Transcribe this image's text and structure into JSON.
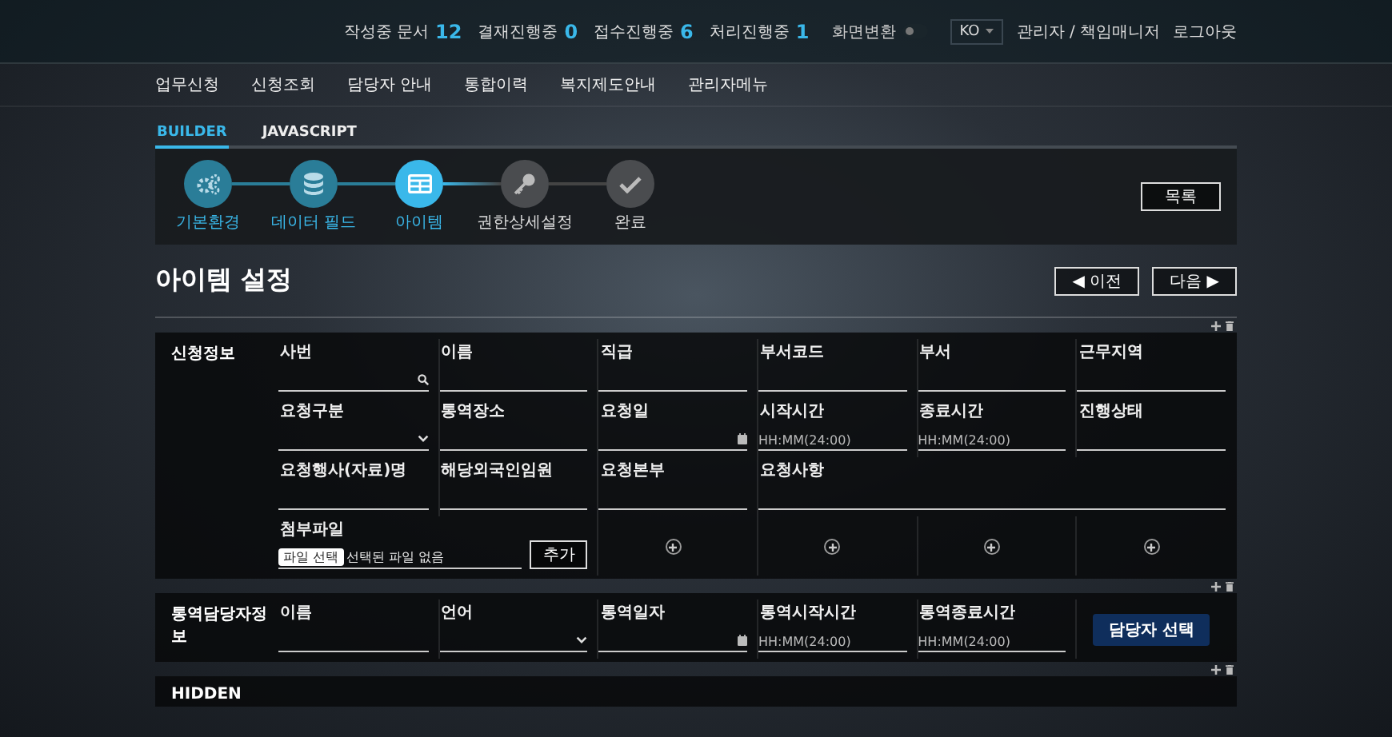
{
  "header": {
    "counters": [
      {
        "label": "작성중 문서",
        "value": "12"
      },
      {
        "label": "결재진행중",
        "value": "0"
      },
      {
        "label": "접수진행중",
        "value": "6"
      },
      {
        "label": "처리진행중",
        "value": "1"
      }
    ],
    "toggle": {
      "label": "화면변환",
      "on": false
    },
    "language": "KO",
    "user": "관리자 / 책임매니저",
    "logout": "로그아웃"
  },
  "nav": [
    "업무신청",
    "신청조회",
    "담당자 안내",
    "통합이력",
    "복지제도안내",
    "관리자메뉴"
  ],
  "tabs": [
    {
      "label": "BUILDER",
      "selected": true
    },
    {
      "label": "JAVASCRIPT",
      "selected": false
    }
  ],
  "steps": [
    {
      "label": "기본환경",
      "completed": true,
      "selected": false
    },
    {
      "label": "데이터 필드",
      "completed": true,
      "selected": false
    },
    {
      "label": "아이템",
      "completed": false,
      "selected": true
    },
    {
      "label": "권한상세설정",
      "completed": false,
      "selected": false
    },
    {
      "label": "완료",
      "completed": false,
      "selected": false
    }
  ],
  "list_button": "목록",
  "page_title": "아이템 설정",
  "prev_button": "◀ 이전",
  "next_button": "다음 ▶",
  "sections": [
    {
      "title": "신청정보",
      "rows": [
        [
          {
            "kind": "search",
            "label": "사번"
          },
          {
            "kind": "text",
            "label": "이름"
          },
          {
            "kind": "text",
            "label": "직급"
          },
          {
            "kind": "text",
            "label": "부서코드"
          },
          {
            "kind": "text",
            "label": "부서"
          },
          {
            "kind": "text",
            "label": "근무지역"
          }
        ],
        [
          {
            "kind": "select",
            "label": "요청구분"
          },
          {
            "kind": "text",
            "label": "통역장소"
          },
          {
            "kind": "date",
            "label": "요청일"
          },
          {
            "kind": "time",
            "label": "시작시간",
            "placeholder": "HH:MM(24:00)"
          },
          {
            "kind": "time",
            "label": "종료시간",
            "placeholder": "HH:MM(24:00)"
          },
          {
            "kind": "text",
            "label": "진행상태"
          }
        ],
        [
          {
            "kind": "text",
            "label": "요청행사(자료)명"
          },
          {
            "kind": "text",
            "label": "해당외국인임원"
          },
          {
            "kind": "text",
            "label": "요청본부"
          },
          {
            "kind": "wide",
            "label": "요청사항"
          }
        ],
        [
          {
            "kind": "file",
            "label": "첨부파일",
            "button_label": "파일 선택",
            "value": "선택된 파일 없음",
            "add_button": "추가"
          },
          {
            "kind": "add"
          },
          {
            "kind": "add"
          },
          {
            "kind": "add"
          },
          {
            "kind": "add"
          }
        ]
      ]
    },
    {
      "title": "통역담당자정보",
      "rows": [
        [
          {
            "kind": "text",
            "label": "이름"
          },
          {
            "kind": "select",
            "label": "언어"
          },
          {
            "kind": "date",
            "label": "통역일자"
          },
          {
            "kind": "time",
            "label": "통역시작시간",
            "placeholder": "HH:MM(24:00)"
          },
          {
            "kind": "time",
            "label": "통역종료시간",
            "placeholder": "HH:MM(24:00)"
          },
          {
            "kind": "button",
            "label": "담당자 선택"
          }
        ]
      ]
    },
    {
      "title": "HIDDEN"
    }
  ]
}
